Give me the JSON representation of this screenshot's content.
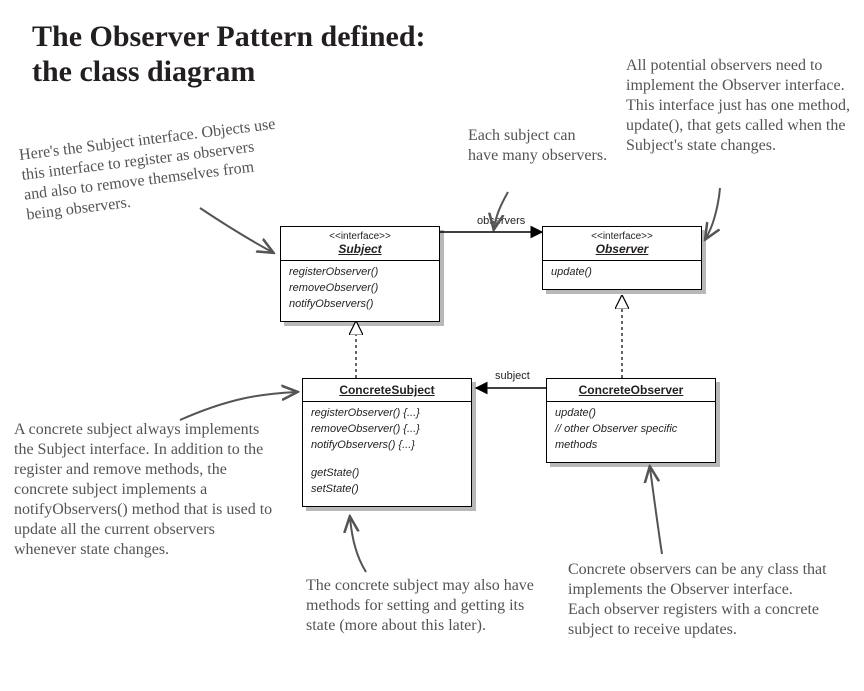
{
  "title_line1": "The Observer Pattern defined:",
  "title_line2": "the class diagram",
  "notes": {
    "subject_intf": "Here's the Subject interface. Objects use this interface to register as observers and also to remove themselves from being observers.",
    "each_subject": "Each subject can have many observers.",
    "observer_intf": "All potential observers need to implement the Observer interface.  This interface just has one method, update(), that gets called when the Subject's state changes.",
    "concrete_subject": "A concrete subject always implements the Subject interface.  In addition to the register and remove methods, the concrete subject implements a notifyObservers() method that is used to update all the current observers whenever state changes.",
    "getset": "The concrete subject may also have methods for setting and getting its state (more about this later).",
    "concrete_observer": "Concrete observers can be any class that implements the Observer interface.  Each observer registers with a concrete subject to receive updates."
  },
  "labels": {
    "observers": "observers",
    "subject": "subject"
  },
  "boxes": {
    "subject": {
      "stereo": "<<interface>>",
      "name": "Subject",
      "methods": [
        "registerObserver()",
        "removeObserver()",
        "notifyObservers()"
      ]
    },
    "observer": {
      "stereo": "<<interface>>",
      "name": "Observer",
      "methods": [
        "update()"
      ]
    },
    "concreteSubject": {
      "name": "ConcreteSubject",
      "methods1": [
        "registerObserver() {...}",
        "removeObserver() {...}",
        "notifyObservers() {...}"
      ],
      "methods2": [
        "getState()",
        "setState()"
      ]
    },
    "concreteObserver": {
      "name": "ConcreteObserver",
      "methods": [
        "update()",
        "// other Observer specific",
        "methods"
      ]
    }
  }
}
